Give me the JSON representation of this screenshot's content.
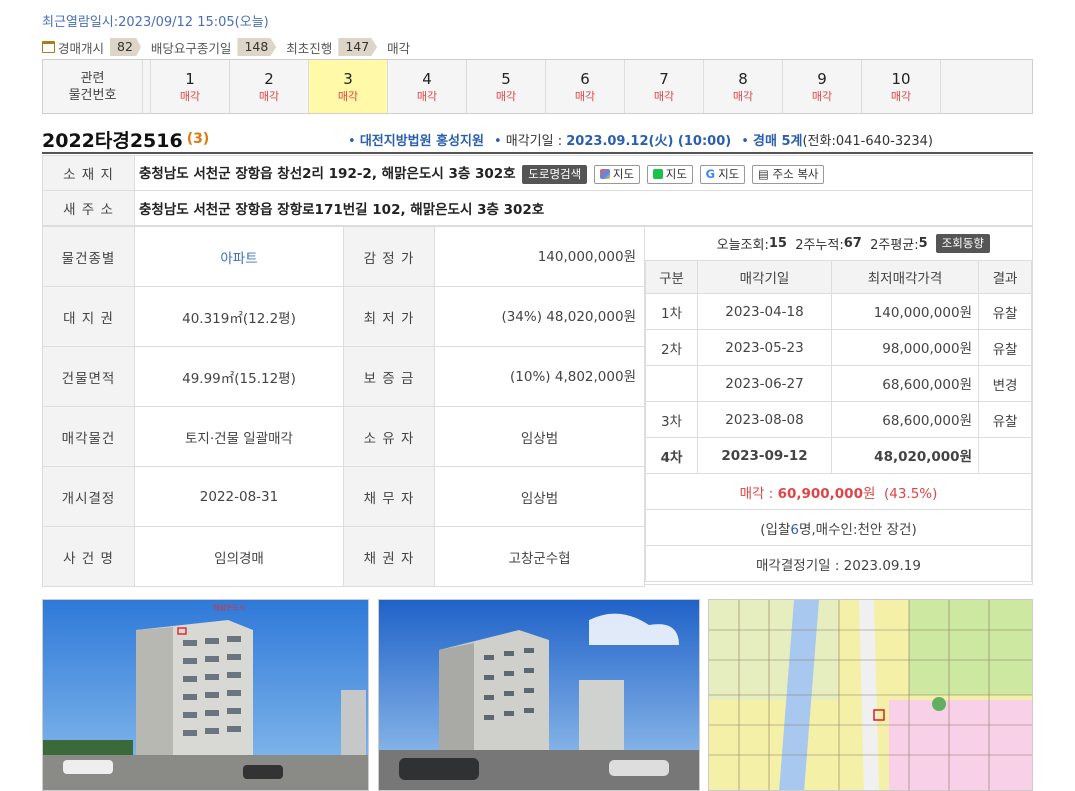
{
  "recent_view": "최근열람일시:2023/09/12 15:05(오늘)",
  "steps": [
    {
      "label": "경매개시",
      "count": "82"
    },
    {
      "label": "배당요구종기일",
      "count": "148"
    },
    {
      "label": "최초진행",
      "count": "147"
    },
    {
      "label": "매각",
      "count": ""
    }
  ],
  "related": {
    "label_line1": "관련",
    "label_line2": "물건번호",
    "items": [
      {
        "no": "1",
        "status": "매각"
      },
      {
        "no": "2",
        "status": "매각"
      },
      {
        "no": "3",
        "status": "매각"
      },
      {
        "no": "4",
        "status": "매각"
      },
      {
        "no": "5",
        "status": "매각"
      },
      {
        "no": "6",
        "status": "매각"
      },
      {
        "no": "7",
        "status": "매각"
      },
      {
        "no": "8",
        "status": "매각"
      },
      {
        "no": "9",
        "status": "매각"
      },
      {
        "no": "10",
        "status": "매각"
      }
    ],
    "selected_index": 2
  },
  "case": {
    "number": "2022타경2516",
    "count": "(3)",
    "court": "대전지방법원 홍성지원",
    "sale_date_label": "매각기일 : ",
    "sale_date": "2023.09.12(火) (10:00)",
    "dept": "경매 5계",
    "phone": "(전화:041-640-3234)"
  },
  "address": {
    "label": "소 재 지",
    "value": "충청남도 서천군 장항읍 창선2리 192-2, 해맑은도시 3층 302호",
    "buttons": [
      "도로명검색",
      "지도",
      "지도",
      "지도",
      "주소 복사"
    ]
  },
  "new_address": {
    "label": "새 주 소",
    "value": "충청남도 서천군 장항읍 장항로171번길 102, 해맑은도시 3층 302호"
  },
  "details": [
    {
      "l1": "물건종별",
      "v1": "아파트",
      "l2": "감 정 가",
      "v2": "140,000,000원"
    },
    {
      "l1": "대 지 권",
      "v1": "40.319㎡(12.2평)",
      "l2": "최 저 가",
      "v2": "(34%) 48,020,000원"
    },
    {
      "l1": "건물면적",
      "v1": "49.99㎡(15.12평)",
      "l2": "보 증 금",
      "v2": "(10%) 4,802,000원"
    },
    {
      "l1": "매각물건",
      "v1": "토지·건물 일괄매각",
      "l2": "소 유 자",
      "v2": "임상범"
    },
    {
      "l1": "개시결정",
      "v1": "2022-08-31",
      "l2": "채 무 자",
      "v2": "임상범"
    },
    {
      "l1": "사 건 명",
      "v1": "임의경매",
      "l2": "채 권 자",
      "v2": "고창군수협"
    }
  ],
  "views": {
    "today_label": "오늘조회: ",
    "today": "15",
    "week_label": "2주누적: ",
    "week": "67",
    "avg_label": "2주평균: ",
    "avg": "5",
    "button": "조회동향"
  },
  "history": {
    "headers": [
      "구분",
      "매각기일",
      "최저매각가격",
      "결과"
    ],
    "rows": [
      {
        "round": "1차",
        "date": "2023-04-18",
        "price": "140,000,000원",
        "result": "유찰"
      },
      {
        "round": "2차",
        "date": "2023-05-23",
        "price": "98,000,000원",
        "result": "유찰"
      },
      {
        "round": "",
        "date": "2023-06-27",
        "price": "68,600,000원",
        "result": "변경"
      },
      {
        "round": "3차",
        "date": "2023-08-08",
        "price": "68,600,000원",
        "result": "유찰"
      },
      {
        "round": "4차",
        "date": "2023-09-12",
        "price": "48,020,000원",
        "result": ""
      }
    ],
    "sold_label": "매각 : ",
    "sold_price": "60,900,000",
    "sold_unit": "원",
    "sold_ratio": "(43.5%)",
    "bid_prefix": "(입찰",
    "bid_count": "6",
    "bid_suffix": "명,매수인:천안 장건)",
    "decision": "매각결정기일 : 2023.09.19"
  },
  "photo_overlay_text": "해맑은도시",
  "colors": {
    "accent_blue": "#2a5fb0",
    "sold_red": "#e04545",
    "selected": "#fff9a8"
  }
}
